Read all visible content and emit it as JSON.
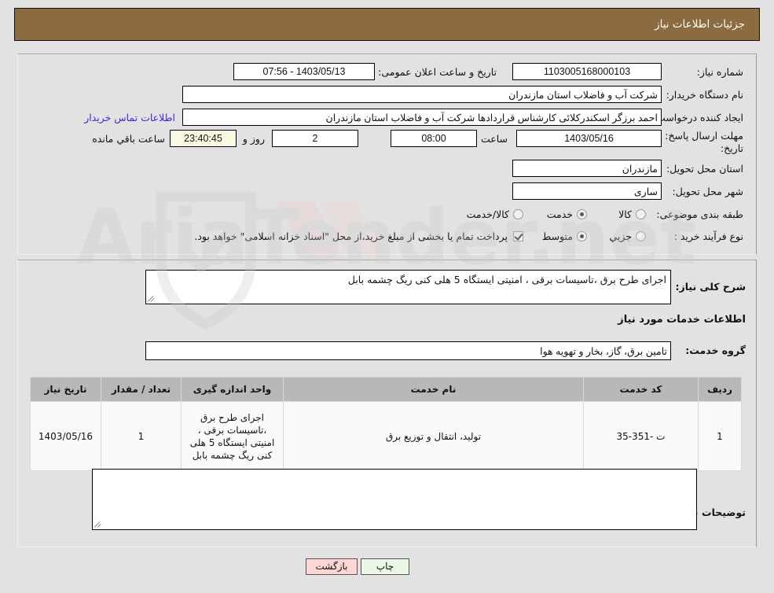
{
  "header": {
    "title": "جزئیات اطلاعات نیاز"
  },
  "top_form": {
    "need_number_label": "شماره نیاز:",
    "need_number_value": "1103005168000103",
    "public_announce_label": "تاریخ و ساعت اعلان عمومی:",
    "public_announce_value": "1403/05/13 - 07:56",
    "buyer_org_label": "نام دستگاه خریدار:",
    "buyer_org_value": "شرکت آب و فاضلاب استان مازندران",
    "requester_label": "ایجاد کننده درخواست:",
    "requester_value": "احمد برزگر اسکندرکلائی کارشناس قراردادها شرکت آب و فاضلاب استان مازندران",
    "contact_link": "اطلاعات تماس خریدار",
    "deadline_label_line1": "مهلت ارسال پاسخ: تا",
    "deadline_label_line2": "تاریخ:",
    "deadline_date": "1403/05/16",
    "hour_label": "ساعت",
    "deadline_time": "08:00",
    "days_value": "2",
    "days_label": "روز و",
    "countdown_value": "23:40:45",
    "remaining_label": "ساعت باقي مانده",
    "delivery_province_label": "استان محل تحویل:",
    "delivery_province_value": "مازندران",
    "delivery_city_label": "شهر محل تحویل:",
    "delivery_city_value": "ساری",
    "category_label": "طبقه بندی موضوعی:",
    "category_options": [
      {
        "label": "کالا",
        "selected": false
      },
      {
        "label": "خدمت",
        "selected": true
      },
      {
        "label": "کالا/خدمت",
        "selected": false
      }
    ],
    "process_label": "نوع فرآیند خرید :",
    "process_options": [
      {
        "label": "جزیي",
        "selected": false
      },
      {
        "label": "متوسط",
        "selected": true
      }
    ],
    "treasury_checkbox_checked": true,
    "treasury_note": "پرداخت تمام یا بخشی از مبلغ خرید،از محل \"اسناد خزانه اسلامی\" خواهد بود."
  },
  "middle": {
    "general_desc_label": "شرح کلی نیاز:",
    "general_desc_value": "اجرای طرح برق ،تاسیسات برقی ، امنیتی ایستگاه 5 هلی کنی ریگ چشمه بابل",
    "services_info_heading": "اطلاعات خدمات مورد نیاز",
    "service_group_label": "گروه خدمت:",
    "service_group_value": "تامین برق، گاز، بخار و تهویه هوا",
    "buyer_notes_label": "توضیحات خریدار:",
    "buyer_notes_value": ""
  },
  "table": {
    "columns": [
      "ردیف",
      "کد خدمت",
      "نام خدمت",
      "واحد اندازه گیری",
      "تعداد / مقدار",
      "تاریخ نیاز"
    ],
    "rows": [
      {
        "row_no": "1",
        "service_code": "ت -351-35",
        "service_name": "تولید، انتقال و توزیع برق",
        "unit": "اجرای طرح برق ،تاسیسات برقی ، امنیتی ایستگاه 5 هلی کنی ریگ چشمه بابل",
        "quantity": "1",
        "need_date": "1403/05/16"
      }
    ]
  },
  "footer": {
    "print_button": "چاپ",
    "back_button": "بازگشت"
  },
  "watermark": {
    "text": "AriaTender.net"
  },
  "colors": {
    "titlebar": "#8c6b40",
    "page_bg": "#e2e2e2",
    "link": "#3b2ad0",
    "table_header": "#b8b8b8",
    "countdown_bg": "#fbfbe4",
    "back_button_bg": "#ffd6d6",
    "print_button_bg": "#eaf7e6"
  }
}
